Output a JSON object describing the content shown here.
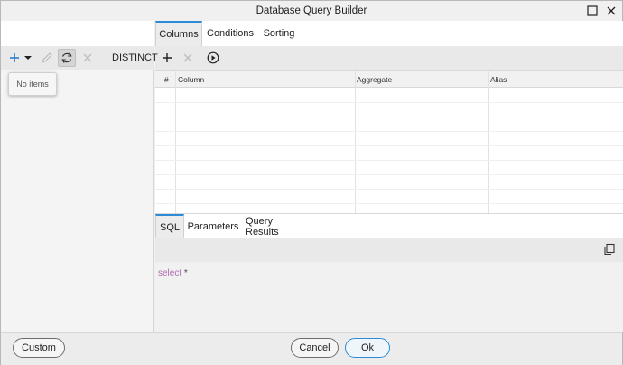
{
  "window": {
    "title": "Database Query Builder"
  },
  "left": {
    "empty_message": "No items"
  },
  "tabs": [
    "Columns",
    "Conditions",
    "Sorting"
  ],
  "toolbar": {
    "distinct_label": "DISTINCT"
  },
  "grid": {
    "headers": [
      "#",
      "Column",
      "Aggregate",
      "Alias"
    ]
  },
  "sql_tabs": [
    "SQL",
    "Parameters",
    "Query Results"
  ],
  "editor": {
    "keyword": "select",
    "rest": " *"
  },
  "buttons": {
    "custom": "Custom",
    "cancel": "Cancel",
    "ok": "Ok"
  },
  "colors": {
    "accent": "#2b8bd6",
    "keyword": "#b06cb0",
    "add_icon": "#1f78c8"
  }
}
